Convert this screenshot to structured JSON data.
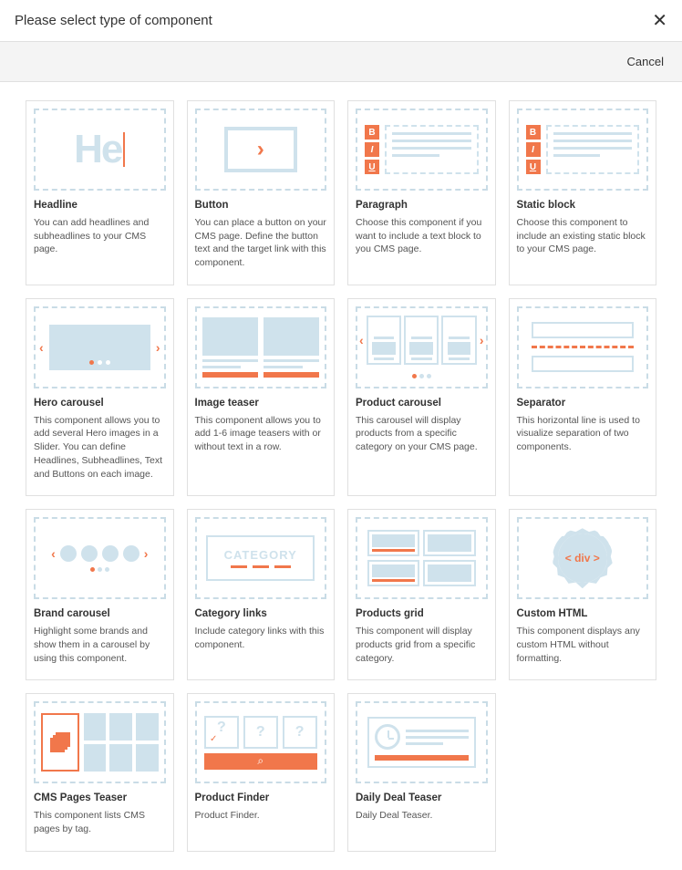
{
  "header": {
    "title": "Please select type of component"
  },
  "actions": {
    "cancel": "Cancel"
  },
  "components": [
    {
      "id": "headline",
      "title": "Headline",
      "desc": "You can add headlines and subheadlines to your CMS page."
    },
    {
      "id": "button",
      "title": "Button",
      "desc": "You can place a button on your CMS page. Define the button text and the target link with this component."
    },
    {
      "id": "paragraph",
      "title": "Paragraph",
      "desc": "Choose this component if you want to include a text block to you CMS page."
    },
    {
      "id": "static-block",
      "title": "Static block",
      "desc": "Choose this component to include an existing static block to your CMS page."
    },
    {
      "id": "hero-carousel",
      "title": "Hero carousel",
      "desc": "This component allows you to add several Hero images in a Slider. You can define Headlines, Subheadlines, Text and Buttons on each image."
    },
    {
      "id": "image-teaser",
      "title": "Image teaser",
      "desc": "This component allows you to add 1-6 image teasers with or without text in a row."
    },
    {
      "id": "product-carousel",
      "title": "Product carousel",
      "desc": "This carousel will display products from a specific category on your CMS page."
    },
    {
      "id": "separator",
      "title": "Separator",
      "desc": "This horizontal line is used to visualize separation of two components."
    },
    {
      "id": "brand-carousel",
      "title": "Brand carousel",
      "desc": "Highlight some brands and show them in a carousel by using this component."
    },
    {
      "id": "category-links",
      "title": "Category links",
      "desc": "Include category links with this component."
    },
    {
      "id": "products-grid",
      "title": "Products grid",
      "desc": "This component will display products grid from a specific category."
    },
    {
      "id": "custom-html",
      "title": "Custom HTML",
      "desc": "This component displays any custom HTML without formatting."
    },
    {
      "id": "cms-pages-teaser",
      "title": "CMS Pages Teaser",
      "desc": "This component lists CMS pages by tag."
    },
    {
      "id": "product-finder",
      "title": "Product Finder",
      "desc": "Product Finder."
    },
    {
      "id": "daily-deal-teaser",
      "title": "Daily Deal Teaser",
      "desc": "Daily Deal Teaser."
    }
  ],
  "illus": {
    "headline_text": "He",
    "category_text": "CATEGORY",
    "div_text": "< div >",
    "biu": [
      "B",
      "I",
      "U"
    ]
  }
}
